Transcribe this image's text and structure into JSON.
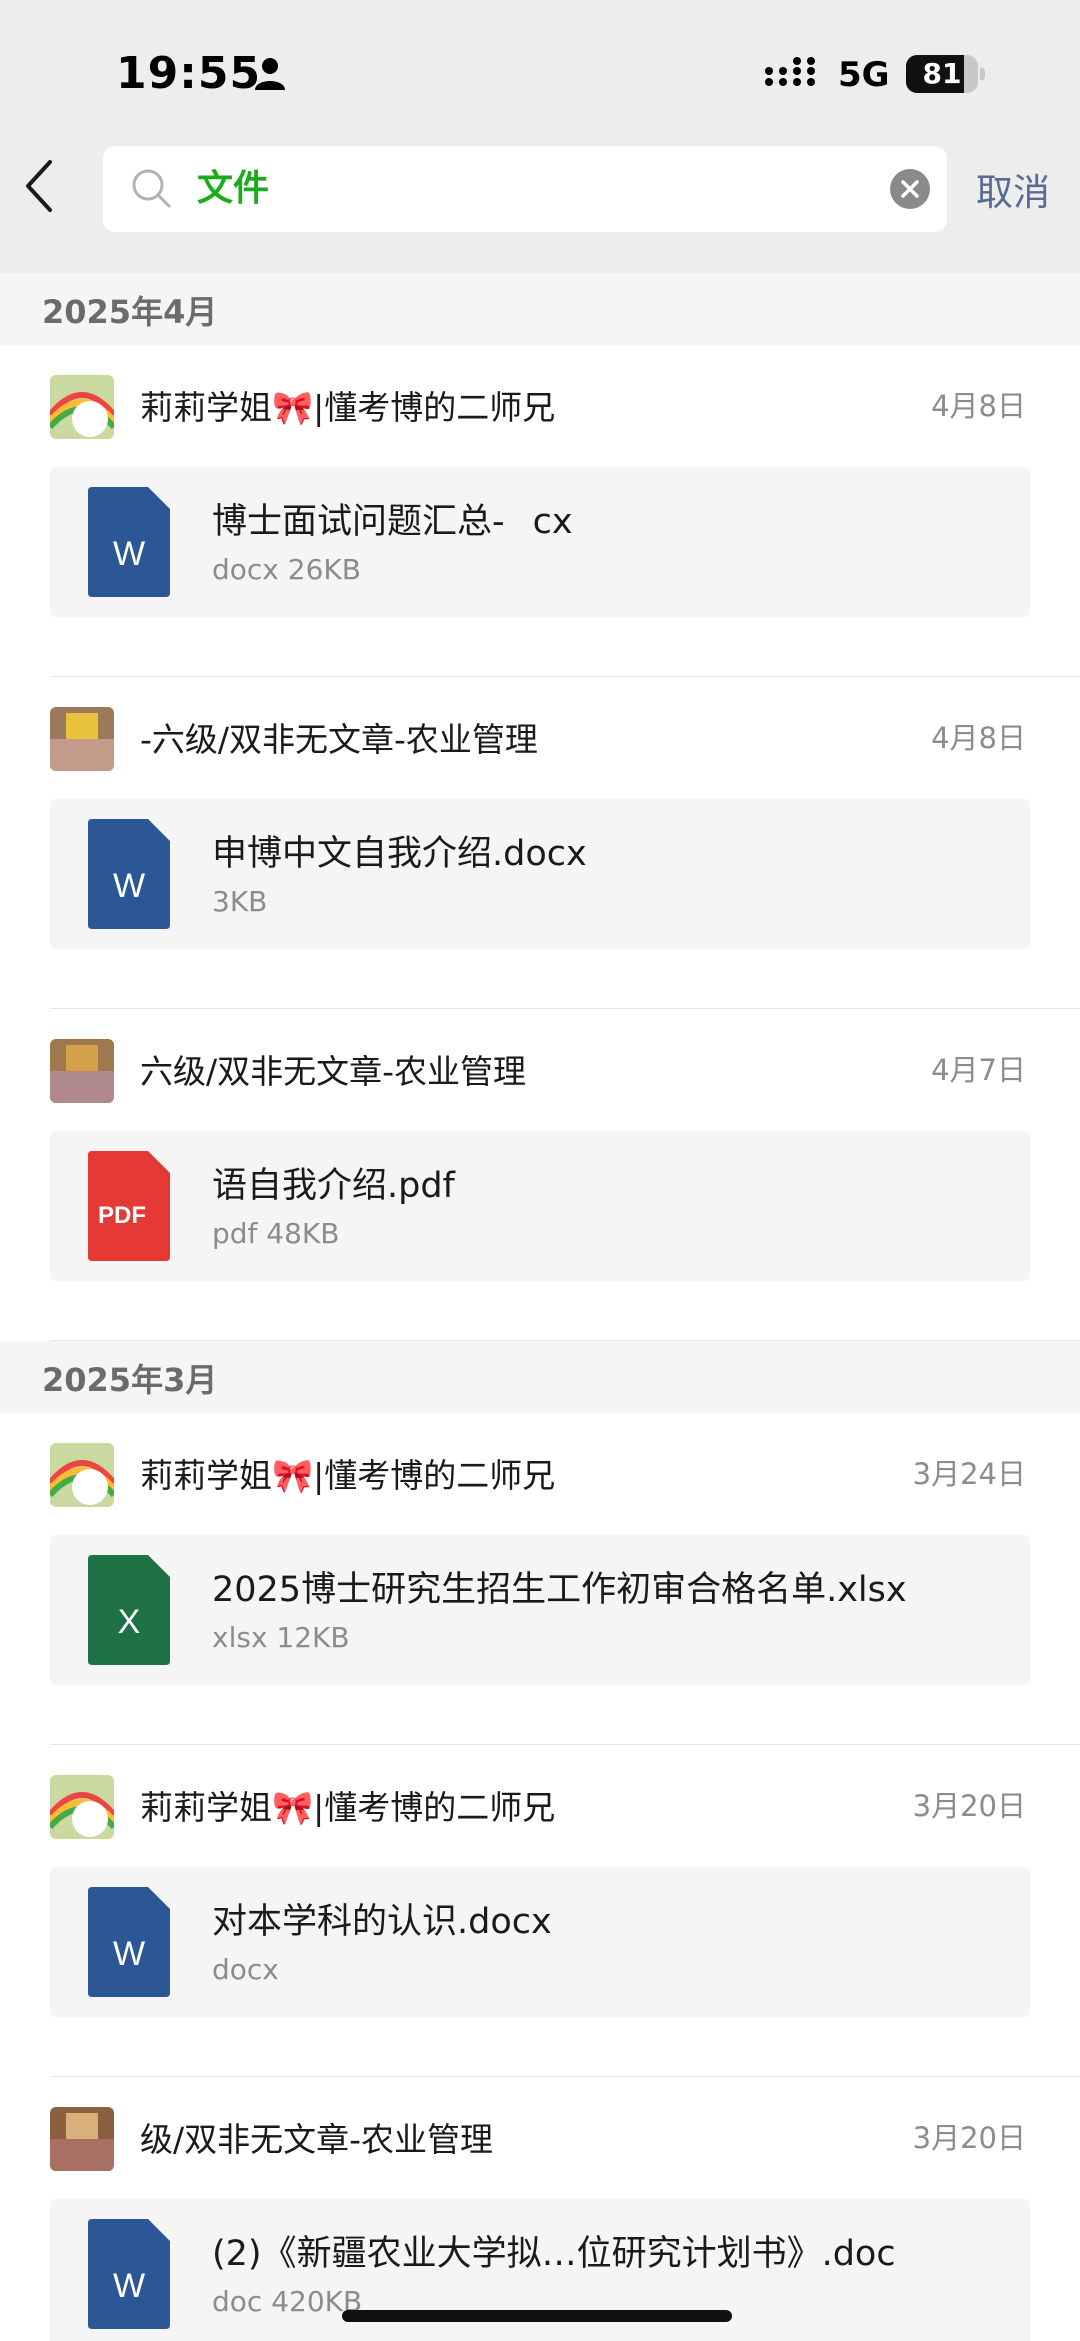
{
  "status": {
    "time": "19:55",
    "network": "5G",
    "battery": "81",
    "battery_level": 0.81
  },
  "search": {
    "query": "文件",
    "cancel_label": "取消"
  },
  "colors": {
    "accent_green": "#1aad19",
    "link_blue": "#576b95",
    "word_blue": "#2b5797",
    "excel_green": "#1e7145",
    "pdf_red": "#e53935"
  },
  "month_1": "2025年4月",
  "month_2": "2025年3月",
  "entries": [
    {
      "sender": "莉莉学姐🎀|懂考博的二师兄",
      "date": "4月8日",
      "file_name": "博士面试问题汇总-    cx",
      "file_meta": "docx 26KB",
      "file_type": "word-icon"
    },
    {
      "sender": "-六级/双非无文章-农业管理",
      "date": "4月8日",
      "file_name": "申博中文自我介绍.docx",
      "file_meta": "3KB",
      "file_type": "word-icon"
    },
    {
      "sender": "六级/双非无文章-农业管理",
      "date": "4月7日",
      "file_name": "语自我介绍.pdf",
      "file_meta": "pdf 48KB",
      "file_type": "pdf-icon"
    },
    {
      "sender": "莉莉学姐🎀|懂考博的二师兄",
      "date": "3月24日",
      "file_name": "2025博士研究生招生工作初审合格名单.xlsx",
      "file_meta": "xlsx 12KB",
      "file_type": "excel-icon"
    },
    {
      "sender": "莉莉学姐🎀|懂考博的二师兄",
      "date": "3月20日",
      "file_name": "对本学科的认识.docx",
      "file_meta": "docx",
      "file_type": "word-icon"
    },
    {
      "sender": "级/双非无文章-农业管理",
      "date": "3月20日",
      "file_name": "(2)《新疆农业大学拟…位研究计划书》.doc",
      "file_meta": "doc 420KB",
      "file_type": "word-icon"
    }
  ]
}
